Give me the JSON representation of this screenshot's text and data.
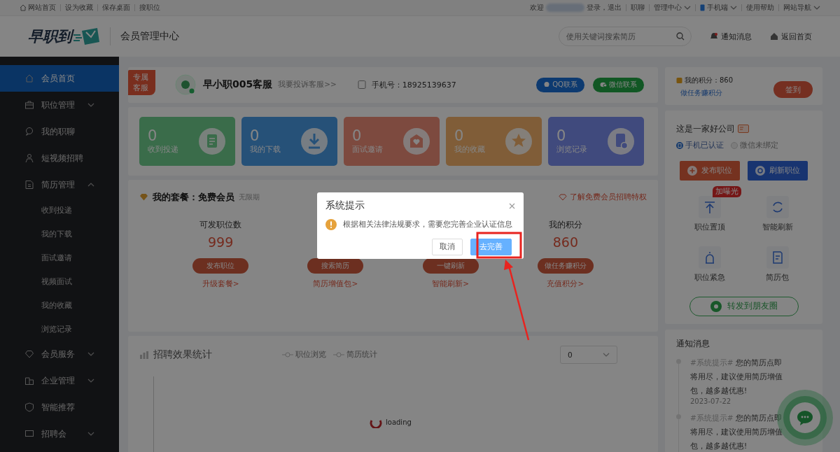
{
  "top_bar": {
    "links": [
      "网站首页",
      "设为收藏",
      "保存桌面",
      "搜职位"
    ],
    "greeting": "欢迎",
    "login_text": "登录，退出",
    "right_links": [
      {
        "label": "职聊",
        "has_menu": false
      },
      {
        "label": "管理中心",
        "has_menu": true
      },
      {
        "label": "手机端",
        "has_menu": true
      },
      {
        "label": "使用帮助",
        "has_menu": false
      },
      {
        "label": "网站导航",
        "has_menu": true
      }
    ]
  },
  "header": {
    "logo": "早职到",
    "title": "会员管理中心",
    "search": {
      "placeholder": "使用关键词搜索简历"
    },
    "links": [
      "通知消息",
      "返回首页"
    ]
  },
  "sidebar": {
    "items": [
      {
        "label": "会员首页",
        "selected": true
      },
      {
        "label": "职位管理",
        "selected": false,
        "expanded": false
      },
      {
        "label": "我的职聊",
        "selected": false
      },
      {
        "label": "短视频招聘",
        "selected": false
      },
      {
        "label": "简历管理",
        "selected": false,
        "expanded": true,
        "children": [
          {
            "label": "收到投递",
            "selected": false
          },
          {
            "label": "我的下载",
            "selected": false
          },
          {
            "label": "面试邀请",
            "selected": false
          },
          {
            "label": "视频面试",
            "selected": false
          },
          {
            "label": "我的收藏",
            "selected": false
          },
          {
            "label": "浏览记录",
            "selected": false
          }
        ]
      },
      {
        "label": "会员服务",
        "selected": false,
        "expanded": false
      },
      {
        "label": "企业管理",
        "selected": false,
        "expanded": false
      },
      {
        "label": "智能推荐",
        "selected": false
      },
      {
        "label": "招聘会",
        "selected": false,
        "expanded": false
      }
    ]
  },
  "service": {
    "badge": [
      "专属",
      "客服"
    ],
    "name": "早小职005客服",
    "complaint_link": "我要投诉客服>>",
    "phone": "手机号：18925139637",
    "buttons": [
      "QQ联系",
      "微信联系"
    ]
  },
  "stats": [
    {
      "value": "0",
      "label": "收到投递"
    },
    {
      "value": "0",
      "label": "我的下载"
    },
    {
      "value": "0",
      "label": "面试邀请"
    },
    {
      "value": "0",
      "label": "我的收藏"
    },
    {
      "value": "0",
      "label": "浏览记录"
    }
  ],
  "package": {
    "title": "我的套餐：免费会员",
    "term": "无限期",
    "privilege_link": "了解免费会员招聘特权",
    "columns": [
      {
        "label": "可发职位数",
        "value": "999",
        "button": "发布职位",
        "link": "升级套餐>"
      },
      {
        "button": "搜索简历",
        "link": "简历增值包>"
      },
      {
        "button": "一键刷新",
        "link": "智能刷新>"
      },
      {
        "label": "我的积分",
        "value": "860",
        "button": "做任务赚积分",
        "link": "充值积分>"
      }
    ]
  },
  "stats_chart": {
    "title": "招聘效果统计",
    "legend": [
      "职位浏览",
      "简历统计"
    ],
    "select": {
      "value": "0"
    },
    "loading": "loading"
  },
  "points": {
    "text": "我的积分：860",
    "link": "做任务赚积分",
    "button": "签到"
  },
  "company": {
    "name": "这是一家好公司",
    "verifications": [
      {
        "label": "手机已认证",
        "verified": true
      },
      {
        "label": "微信未绑定",
        "verified": false
      }
    ],
    "buttons": [
      "发布职位",
      "刷新职位"
    ],
    "tools": [
      {
        "label": "职位置顶",
        "badge": "加曝光"
      },
      {
        "label": "智能刷新"
      },
      {
        "label": "职位紧急"
      },
      {
        "label": "简历包"
      }
    ],
    "share": "转发到朋友圈"
  },
  "notices": {
    "title": "通知消息",
    "items": [
      {
        "tag": "#系统提示#",
        "text": "您的简历点即将用尽，建议使用简历增值包，越多越优惠!",
        "date": "2023-07-22"
      },
      {
        "tag": "#系统提示#",
        "text": "您的简历点即将用尽，建议使用简历增值包，越多越优惠!"
      }
    ]
  },
  "modal": {
    "title": "系统提示",
    "message": "根据相关法律法规要求，需要您完善企业认证信息",
    "buttons": [
      {
        "label": "取消",
        "kind": "secondary"
      },
      {
        "label": "去完善",
        "kind": "primary"
      }
    ]
  }
}
